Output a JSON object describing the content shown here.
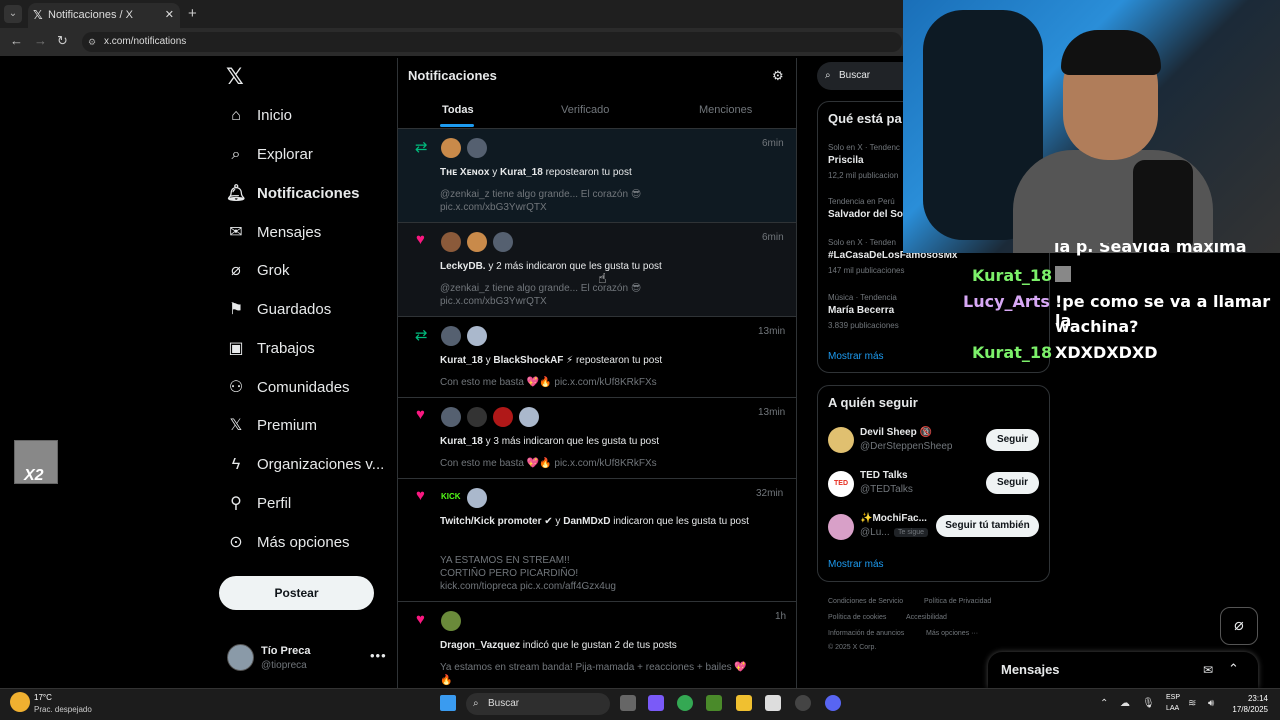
{
  "browser": {
    "tab_title": "Notificaciones / X",
    "url": "x.com/notifications"
  },
  "sidebar": {
    "items": [
      {
        "label": "Inicio",
        "icon": "home-icon"
      },
      {
        "label": "Explorar",
        "icon": "search-icon"
      },
      {
        "label": "Notificaciones",
        "icon": "bell-icon"
      },
      {
        "label": "Mensajes",
        "icon": "mail-icon"
      },
      {
        "label": "Grok",
        "icon": "grok-icon"
      },
      {
        "label": "Guardados",
        "icon": "bookmark-icon"
      },
      {
        "label": "Trabajos",
        "icon": "briefcase-icon"
      },
      {
        "label": "Comunidades",
        "icon": "people-icon"
      },
      {
        "label": "Premium",
        "icon": "x-logo-icon"
      },
      {
        "label": "Organizaciones v...",
        "icon": "lightning-icon"
      },
      {
        "label": "Perfil",
        "icon": "person-icon"
      },
      {
        "label": "Más opciones",
        "icon": "more-circle-icon"
      }
    ],
    "post_button": "Postear",
    "account": {
      "name": "Tío Preca",
      "handle": "@tiopreca"
    }
  },
  "main": {
    "title": "Notificaciones",
    "tabs": [
      "Todas",
      "Verificado",
      "Menciones"
    ],
    "notifications": [
      {
        "type": "repost",
        "time": "6min",
        "users": "Tʜᴇ Xᴇɴᴏx",
        "joiner": " y ",
        "users2": "Kurat_18",
        "action": " repostearon tu post",
        "sub1": "@zenkai_z tiene algo grande... El corazón 😎",
        "sub2": "pic.x.com/xbG3YwrQTX"
      },
      {
        "type": "like",
        "time": "6min",
        "users": "LeckyDB.",
        "joiner": "",
        "users2": "",
        "action": " y 2 más indicaron que les gusta tu post",
        "sub1": "@zenkai_z tiene algo grande... El corazón 😎",
        "sub2": "pic.x.com/xbG3YwrQTX"
      },
      {
        "type": "repost",
        "time": "13min",
        "users": "Kurat_18",
        "joiner": " y ",
        "users2": "BlackShockAF ⚡",
        "action": " repostearon tu post",
        "sub1": "Con esto me basta 💖🔥 pic.x.com/kUf8KRkFXs",
        "sub2": ""
      },
      {
        "type": "like",
        "time": "13min",
        "users": "Kurat_18",
        "joiner": "",
        "users2": "",
        "action": " y 3 más indicaron que les gusta tu post",
        "sub1": "Con esto me basta 💖🔥 pic.x.com/kUf8KRkFXs",
        "sub2": ""
      },
      {
        "type": "like",
        "time": "32min",
        "users": "Twitch/Kick promoter ✔",
        "joiner": " y ",
        "users2": "DanMDxD",
        "action": " indicaron que les gusta tu post",
        "sub1": "YA ESTAMOS EN STREAM!!",
        "sub2": "CORTIÑO PERO PICARDIÑO!",
        "sub3": "kick.com/tiopreca pic.x.com/aff4Gzx4ug"
      },
      {
        "type": "like",
        "time": "1h",
        "users": "Dragon_Vazquez",
        "joiner": "",
        "users2": "",
        "action": " indicó que le gustan 2 de tus posts",
        "sub1": "Ya estamos en stream banda! Pija-mamada + reacciones + bailes 💖",
        "sub2": "🔥"
      }
    ]
  },
  "right": {
    "search_placeholder": "Buscar",
    "trends_title": "Qué está pa",
    "trends": [
      {
        "meta": "Solo en X · Tendenc",
        "name": "Priscila",
        "count": "12,2 mil publicacion"
      },
      {
        "meta": "Tendencia en Perú",
        "name": "Salvador del So",
        "count": ""
      },
      {
        "meta": "Solo en X · Tenden",
        "name": "#LaCasaDeLosFamososMx",
        "count": "147 mil publicaciones"
      },
      {
        "meta": "Música · Tendencia",
        "name": "María Becerra",
        "count": "3.839 publicaciones"
      }
    ],
    "trends_more": "Mostrar más",
    "follow_title": "A quién seguir",
    "follow": [
      {
        "name": "Devil Sheep 🔞",
        "handle": "@DerSteppenSheep",
        "button": "Seguir"
      },
      {
        "name": "TED Talks",
        "handle": "@TEDTalks",
        "button": "Seguir"
      },
      {
        "name": "✨MochiFac...",
        "handle": "@Lu...",
        "badge": "Te sigue",
        "button": "Seguir tú también"
      }
    ],
    "follow_more": "Mostrar más",
    "footer": [
      "Condiciones de Servicio",
      "Política de Privacidad",
      "Política de cookies",
      "Accesibilidad",
      "Información de anuncios",
      "Más opciones ···",
      "© 2025 X Corp."
    ]
  },
  "messages_drawer": {
    "title": "Mensajes"
  },
  "chat_overlay": [
    {
      "user": "",
      "msg": "la p. Seavida maxima",
      "user_color": "#7cf06a"
    },
    {
      "user": "Kurat_18",
      "msg": "",
      "user_color": "#7cf06a"
    },
    {
      "user": "Lucy_Arts",
      "msg": "!pe como se va a llamar la",
      "user_color": "#d7a8f5"
    },
    {
      "user": "",
      "msg": "wachina?",
      "user_color": "#d7a8f5"
    },
    {
      "user": "Kurat_18",
      "msg": "XDXDXDXD",
      "user_color": "#7cf06a"
    }
  ],
  "sticker_text": "X2",
  "taskbar": {
    "temp": "17°C",
    "condition": "Prac. despejado",
    "search": "Buscar",
    "lang1": "ESP",
    "lang2": "LAA",
    "time": "23:14",
    "date": "17/8/2025"
  },
  "colors": {
    "accent": "#1d9bf0",
    "like": "#f91880",
    "repost": "#00ba7c",
    "kurat": "#7cf06a",
    "lucy": "#d7a8f5"
  }
}
